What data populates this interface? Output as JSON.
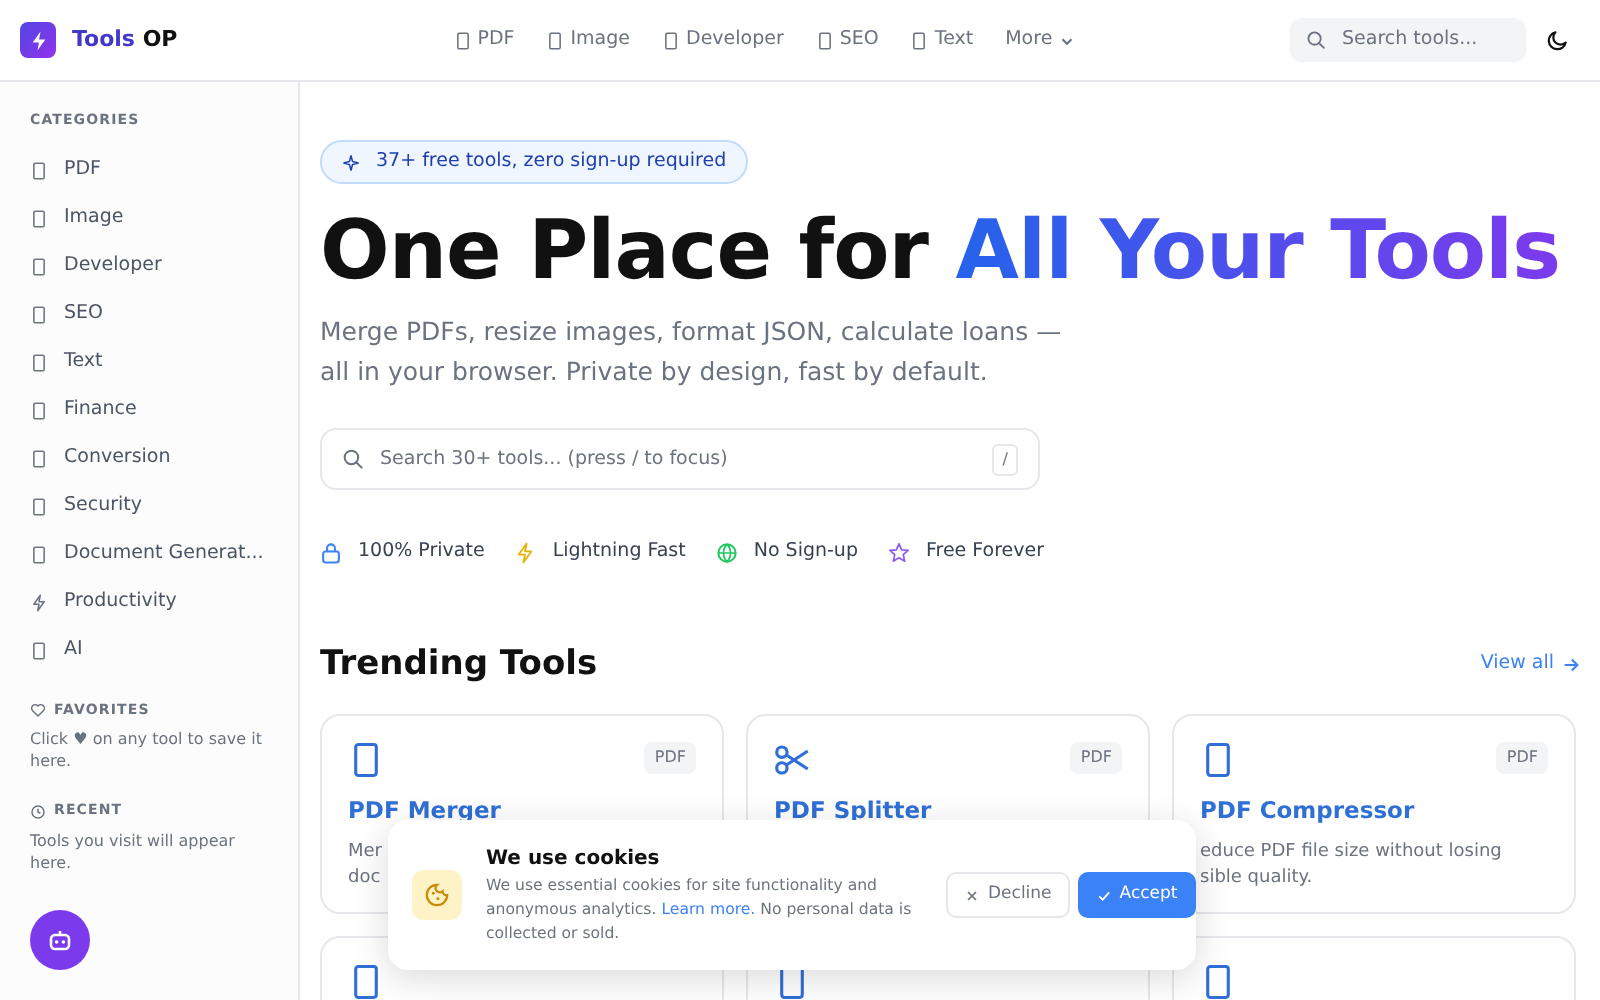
{
  "navbar": {
    "logo": {
      "text_start": "Tools",
      "text_end": "OP"
    },
    "links": [
      {
        "label": "PDF",
        "kind": "box"
      },
      {
        "label": "Image",
        "kind": "box"
      },
      {
        "label": "Developer",
        "kind": "box"
      },
      {
        "label": "SEO",
        "kind": "box"
      },
      {
        "label": "Text",
        "kind": "box"
      },
      {
        "label": "More",
        "kind": "dropdown"
      }
    ],
    "search": {
      "placeholder": "Search tools..."
    }
  },
  "sidebar": {
    "categories_title": "CATEGORIES",
    "categories": [
      {
        "label": "PDF",
        "kind": "box"
      },
      {
        "label": "Image",
        "kind": "box"
      },
      {
        "label": "Developer",
        "kind": "box"
      },
      {
        "label": "SEO",
        "kind": "box"
      },
      {
        "label": "Text",
        "kind": "box"
      },
      {
        "label": "Finance",
        "kind": "box"
      },
      {
        "label": "Conversion",
        "kind": "box"
      },
      {
        "label": "Security",
        "kind": "box"
      },
      {
        "label": "Document Generat...",
        "kind": "box"
      },
      {
        "label": "Productivity",
        "kind": "bolt"
      },
      {
        "label": "AI",
        "kind": "box"
      }
    ],
    "favorites": {
      "title": "FAVORITES",
      "text": "Click ♥ on any tool to save it here."
    },
    "recent": {
      "title": "RECENT",
      "text": "Tools you visit will appear here."
    }
  },
  "hero": {
    "badge": "37+ free tools, zero sign-up required",
    "title": "One Place for",
    "title_highlight": "All Your Tools",
    "subtitle": "Merge PDFs, resize images, format JSON, calculate loans — all in your browser. Private by design, fast by default.",
    "search": {
      "placeholder": "Search 30+ tools... (press / to focus)",
      "shortcut": "/"
    },
    "features": [
      {
        "label": "100% Private",
        "kind": "lock"
      },
      {
        "label": "Lightning Fast",
        "kind": "bolt"
      },
      {
        "label": "No Sign-up",
        "kind": "globe"
      },
      {
        "label": "Free Forever",
        "kind": "star"
      }
    ]
  },
  "trending": {
    "title": "Trending Tools",
    "view_all": "View all",
    "tools": [
      {
        "kind": "box",
        "badge": "PDF",
        "name": "PDF Merger",
        "description": [
          "Mer",
          "doc"
        ]
      },
      {
        "kind": "scissors",
        "badge": "PDF",
        "name": "PDF Splitter"
      },
      {
        "kind": "box",
        "badge": "PDF",
        "name": "PDF Compressor",
        "description": [
          "educe PDF file size without losing",
          "sible quality."
        ]
      },
      {
        "kind": "box"
      },
      {
        "kind": "box"
      },
      {
        "kind": "box"
      }
    ]
  },
  "cookie_banner": {
    "title": "We use cookies",
    "text_start": "We use essential cookies for site functionality and anonymous analytics.",
    "link": "Learn more.",
    "text_end": "No personal data is collected or sold.",
    "buttons": [
      {
        "label": "Decline",
        "kind": "secondary"
      },
      {
        "label": "Accept",
        "kind": "primary"
      }
    ]
  }
}
